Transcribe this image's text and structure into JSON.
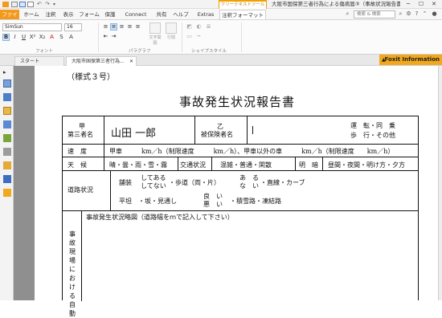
{
  "titlebar": {
    "context_tab": "フリーテキストツール",
    "doc_title": "大阪市国保第三者行為による傷病届③（事故状況報告書）.pdf -..."
  },
  "menu": {
    "tabs": [
      "ファイル",
      "ホーム",
      "注釈",
      "表示",
      "フォーム",
      "保護",
      "Connect",
      "共有",
      "ヘルプ",
      "Extras",
      "注釈フォーマット"
    ],
    "search_placeholder": "検索 & 検索"
  },
  "ribbon": {
    "font_name": "SimSun",
    "font_size": "16",
    "groups": [
      "フォント",
      "パラグラフ",
      "シェイプスタイル"
    ],
    "align_labels": [
      "文字間隔",
      "行間"
    ]
  },
  "doc_tabs": [
    "スタート",
    "大阪市国保第三者行為..."
  ],
  "foxit_info": "Foxit Information",
  "document": {
    "form_no": "（様式３号）",
    "title": "事故発生状況報告書",
    "row1": {
      "party_a_label_top": "甲",
      "party_a_label_bottom": "第三者名",
      "party_a_value": "山田 一郎",
      "party_b_label_top": "乙",
      "party_b_label_bottom": "被保険者名",
      "party_b_value": "",
      "role_line1": "運　転・同　乗",
      "role_line2": "歩　行・その他"
    },
    "row2": {
      "label": "速　度",
      "text": "甲車　　　km／h（制限速度　　　km／h）、甲車以外の車　　　km／h（制限速度　　km／h）"
    },
    "row3": {
      "label": "天　候",
      "weather": "晴・曇・雨・雪・霧",
      "traffic_label": "交通状況",
      "traffic": "混雑・普通・閑散",
      "light_label": "明　暗",
      "light": "昼間・夜間・明け方・夕方"
    },
    "row4": {
      "label": "道路状況",
      "line1_left": "舗装",
      "line1_mid_top": "してある",
      "line1_mid_bottom": "してない",
      "line1_right": "・歩道（両・片）",
      "line1_exist_top": "あ　る",
      "line1_exist_bottom": "な　い",
      "line1_end": "・直線・カーブ",
      "line2_left": "平坦　・坂・見通し",
      "line2_mid_top": "良　い",
      "line2_mid_bottom": "悪　い",
      "line2_end": "・積雪路・凍結路"
    },
    "row5": {
      "vertical_label": "事故現場における自動",
      "sketch_caption": "事故発生状況略図（道路幅をｍで記入して下さい）"
    }
  }
}
